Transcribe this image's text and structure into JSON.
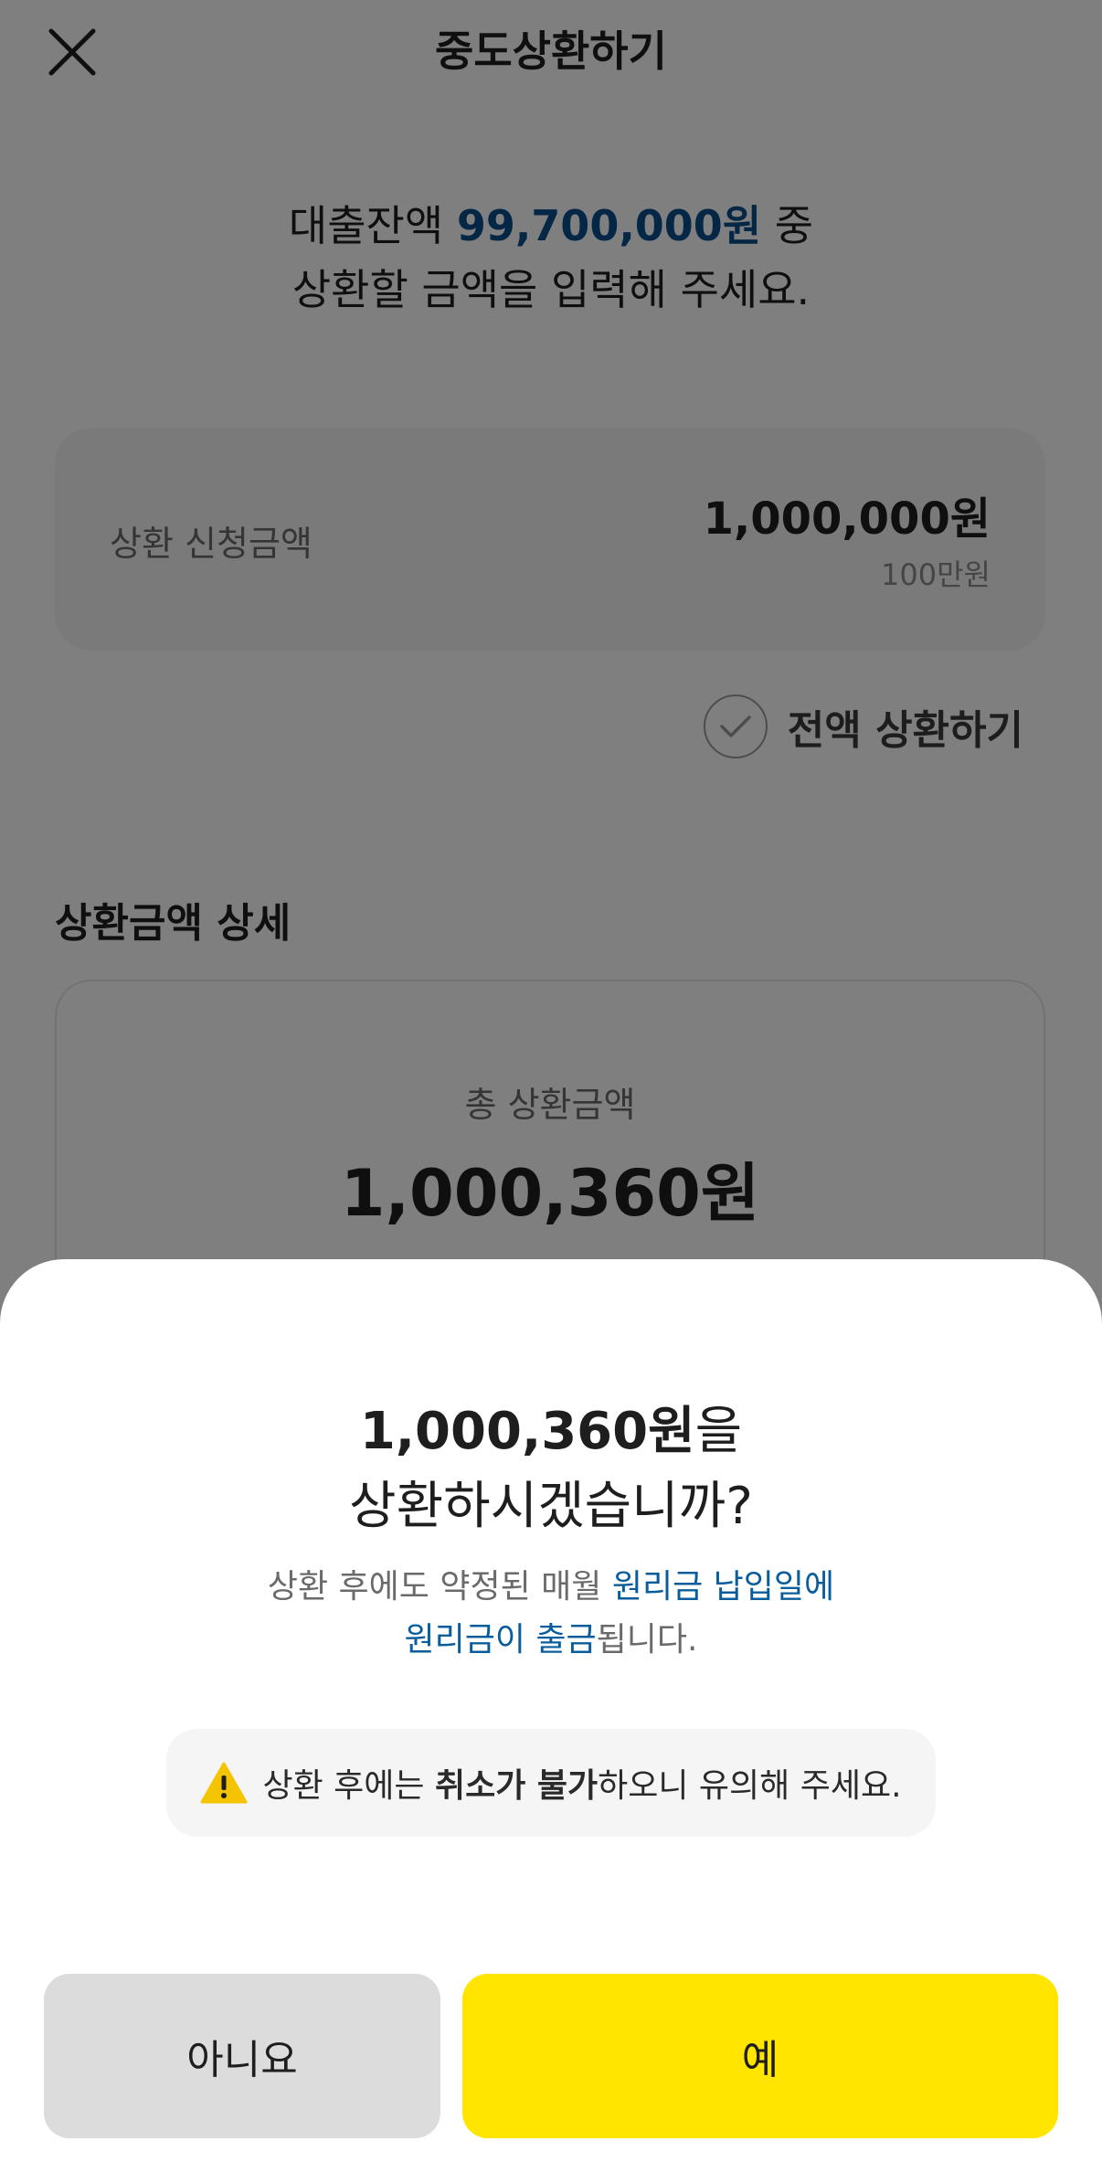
{
  "header": {
    "title": "중도상환하기",
    "close_icon": "close-icon"
  },
  "intro": {
    "prefix": "대출잔액 ",
    "balance": "99,700,000원",
    "suffix": " 중",
    "line2": "상환할 금액을 입력해 주세요."
  },
  "amount_card": {
    "label": "상환 신청금액",
    "value": "1,000,000원",
    "sub": "100만원"
  },
  "full_repay": {
    "label": "전액 상환하기",
    "icon": "check-icon"
  },
  "detail": {
    "section_title": "상환금액 상세",
    "total_label": "총 상환금액",
    "total_value": "1,000,360원"
  },
  "sheet": {
    "title_amount": "1,000,360원",
    "title_suffix": "을",
    "title_line2": "상환하시겠습니까?",
    "desc_prefix": "상환 후에도 약정된 매월 ",
    "desc_link1": "원리금 납입일에",
    "desc_link2": "원리금이 출금",
    "desc_suffix": "됩니다.",
    "notice_prefix": "상환 후에는 ",
    "notice_bold": "취소가 불가",
    "notice_suffix": "하오니 유의해 주세요.",
    "notice_icon": "warning-icon",
    "no_label": "아니요",
    "yes_label": "예"
  },
  "colors": {
    "accent_yellow": "#ffe500",
    "link_blue": "#0a5d9c",
    "warning_yellow": "#f5c400"
  }
}
